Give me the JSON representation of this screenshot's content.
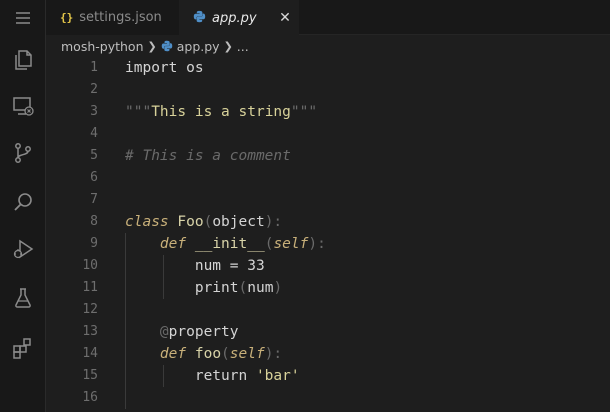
{
  "tabs": [
    {
      "icon": "json-icon",
      "icon_text": "{}",
      "label": "settings.json",
      "active": false
    },
    {
      "icon": "python-icon",
      "label": "app.py",
      "active": true,
      "close": "✕"
    }
  ],
  "breadcrumb": {
    "folder": "mosh-python",
    "file": "app.py",
    "more": "..."
  },
  "activity_bar": [
    "menu-icon",
    "explorer-icon",
    "remote-explorer-icon",
    "source-control-icon",
    "search-icon",
    "run-debug-icon",
    "testing-icon",
    "extensions-icon"
  ],
  "editor": {
    "line_numbers": [
      "1",
      "2",
      "3",
      "4",
      "5",
      "6",
      "7",
      "8",
      "9",
      "10",
      "11",
      "12",
      "13",
      "14",
      "15",
      "16"
    ],
    "lines": [
      [
        {
          "t": "import os",
          "c": "plain"
        }
      ],
      [],
      [
        {
          "t": "\"\"\"",
          "c": "dim"
        },
        {
          "t": "This is a string",
          "c": "str"
        },
        {
          "t": "\"\"\"",
          "c": "dim"
        }
      ],
      [],
      [
        {
          "t": "# This is a comment",
          "c": "cm"
        }
      ],
      [],
      [],
      [
        {
          "t": "class",
          "c": "it"
        },
        {
          "t": " Foo",
          "c": "fn"
        },
        {
          "t": "(",
          "c": "dim"
        },
        {
          "t": "object",
          "c": "plain"
        },
        {
          "t": "):",
          "c": "dim"
        }
      ],
      [
        {
          "t": "    ",
          "c": "plain"
        },
        {
          "t": "def",
          "c": "it"
        },
        {
          "t": " __init__",
          "c": "fn"
        },
        {
          "t": "(",
          "c": "dim"
        },
        {
          "t": "self",
          "c": "it"
        },
        {
          "t": "):",
          "c": "dim"
        }
      ],
      [
        {
          "t": "        num = 33",
          "c": "plain"
        }
      ],
      [
        {
          "t": "        print",
          "c": "plain"
        },
        {
          "t": "(",
          "c": "dim"
        },
        {
          "t": "num",
          "c": "plain"
        },
        {
          "t": ")",
          "c": "dim"
        }
      ],
      [],
      [
        {
          "t": "    ",
          "c": "plain"
        },
        {
          "t": "@",
          "c": "dim"
        },
        {
          "t": "property",
          "c": "plain"
        }
      ],
      [
        {
          "t": "    ",
          "c": "plain"
        },
        {
          "t": "def",
          "c": "it"
        },
        {
          "t": " foo",
          "c": "fn"
        },
        {
          "t": "(",
          "c": "dim"
        },
        {
          "t": "self",
          "c": "it"
        },
        {
          "t": "):",
          "c": "dim"
        }
      ],
      [
        {
          "t": "        return ",
          "c": "plain"
        },
        {
          "t": "'bar'",
          "c": "str"
        }
      ],
      []
    ]
  }
}
